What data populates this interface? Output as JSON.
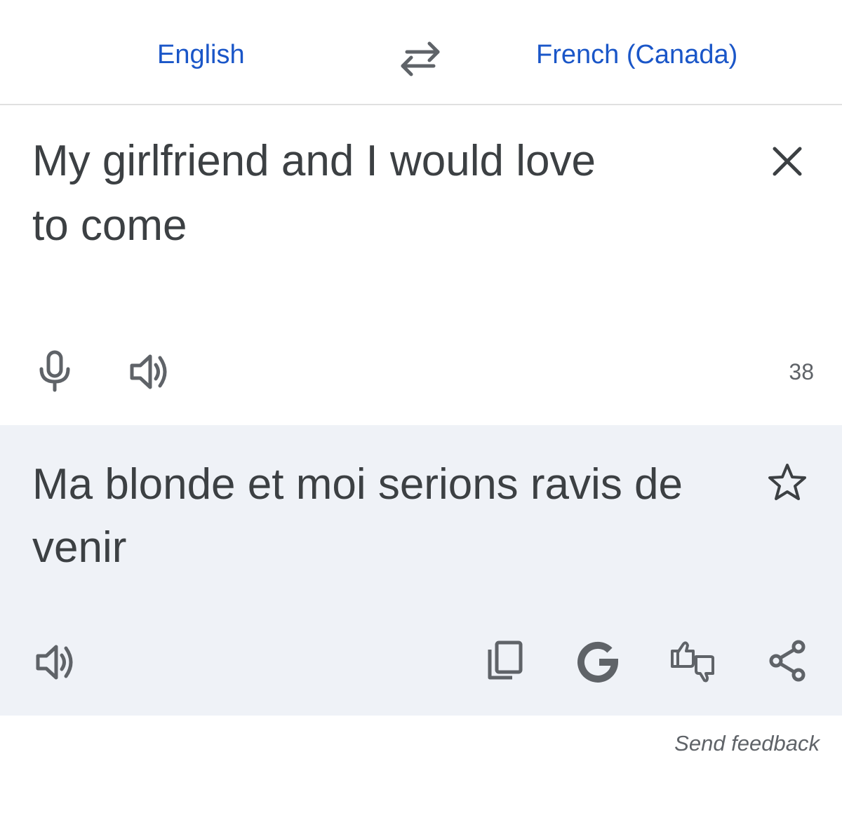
{
  "language_bar": {
    "source_language": "English",
    "target_language": "French (Canada)",
    "swap_icon": "swap-arrows-icon"
  },
  "source": {
    "text": "My girlfriend and I would love to come",
    "character_count": "38",
    "icons": [
      "close-icon",
      "microphone-icon",
      "speaker-icon"
    ]
  },
  "result": {
    "text": "Ma blonde et moi serions ravis de venir",
    "icons": [
      "star-icon",
      "speaker-icon",
      "copy-icon",
      "google-icon",
      "feedback-thumbs-icon",
      "share-icon"
    ]
  },
  "footer": {
    "send_feedback": "Send feedback"
  },
  "colors": {
    "accent": "#1a56c8",
    "text": "#3c4043",
    "icon": "#5f6368",
    "result_background": "#eff2f7"
  }
}
